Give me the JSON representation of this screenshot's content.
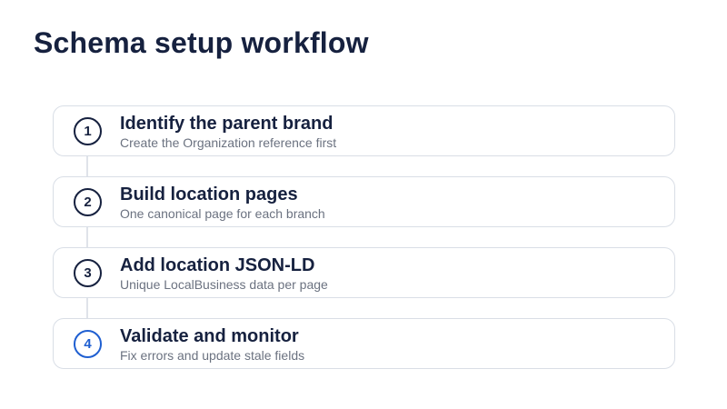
{
  "title": "Schema setup workflow",
  "steps": [
    {
      "number": "1",
      "title": "Identify the parent brand",
      "description": "Create the Organization reference first"
    },
    {
      "number": "2",
      "title": "Build location pages",
      "description": "One canonical page for each branch"
    },
    {
      "number": "3",
      "title": "Add location JSON-LD",
      "description": "Unique LocalBusiness data per page"
    },
    {
      "number": "4",
      "title": "Validate and monitor",
      "description": "Fix errors and update stale fields"
    }
  ],
  "colors": {
    "title": "#16213f",
    "description": "#6b7280",
    "border": "#d9dee6",
    "connector": "#dfe3ea",
    "active_step": "#1f5fd1"
  }
}
